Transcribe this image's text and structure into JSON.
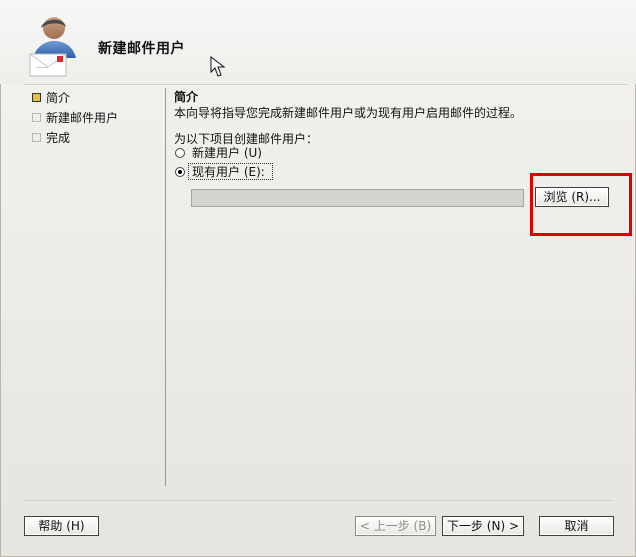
{
  "window": {
    "title": "新建邮件用户"
  },
  "nav": {
    "items": [
      {
        "label": "简介",
        "active": true
      },
      {
        "label": "新建邮件用户",
        "active": false
      },
      {
        "label": "完成",
        "active": false
      }
    ]
  },
  "main": {
    "section_title": "简介",
    "description": "本向导将指导您完成新建邮件用户或为现有用户启用邮件的过程。",
    "group_label": "为以下项目创建邮件用户：",
    "options": [
      {
        "label": "新建用户 (U)",
        "selected": false
      },
      {
        "label": "现有用户 (E):",
        "selected": true
      }
    ],
    "existing_user_value": "",
    "browse_button": "浏览 (R)..."
  },
  "footer": {
    "help_button": "帮助 (H)",
    "back_button": "< 上一步 (B)",
    "next_button": "下一步 (N) >",
    "cancel_button": "取消"
  },
  "colors": {
    "highlight": "#e00000",
    "active_nav_marker": "#e2c13a"
  },
  "icons": {
    "wizard_icon": "user-mail-icon",
    "pointer": "mouse-pointer-icon"
  }
}
